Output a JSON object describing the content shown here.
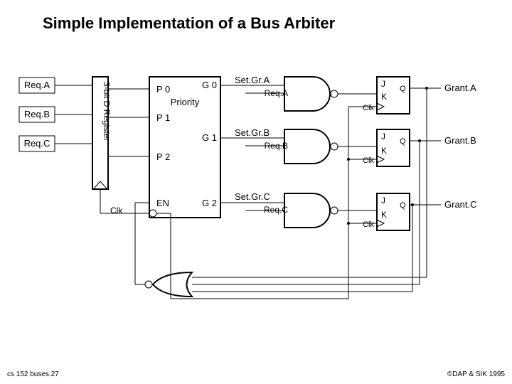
{
  "title": "Simple Implementation of a Bus Arbiter",
  "footer_left": "cs 152 buses.27",
  "footer_right": "©DAP & SIK 1995",
  "register": {
    "label": "3-bit D Register"
  },
  "priority": {
    "title": "Priority",
    "p0": "P 0",
    "p1": "P 1",
    "p2": "P 2",
    "en": "EN",
    "g0": "G 0",
    "g1": "G 1",
    "g2": "G 2"
  },
  "inputs": {
    "a": "Req.A",
    "b": "Req.B",
    "c": "Req.C"
  },
  "sets": {
    "a": "Set.Gr.A",
    "b": "Set.Gr.B",
    "c": "Set.Gr.C"
  },
  "reqs": {
    "a": "Req.A",
    "b": "Req.B",
    "c": "Req.C"
  },
  "grants": {
    "a": "Grant.A",
    "b": "Grant.B",
    "c": "Grant.C"
  },
  "jk": {
    "j": "J",
    "k": "K",
    "q": "Q",
    "clk": "Clk"
  },
  "clk_label": "Clk"
}
